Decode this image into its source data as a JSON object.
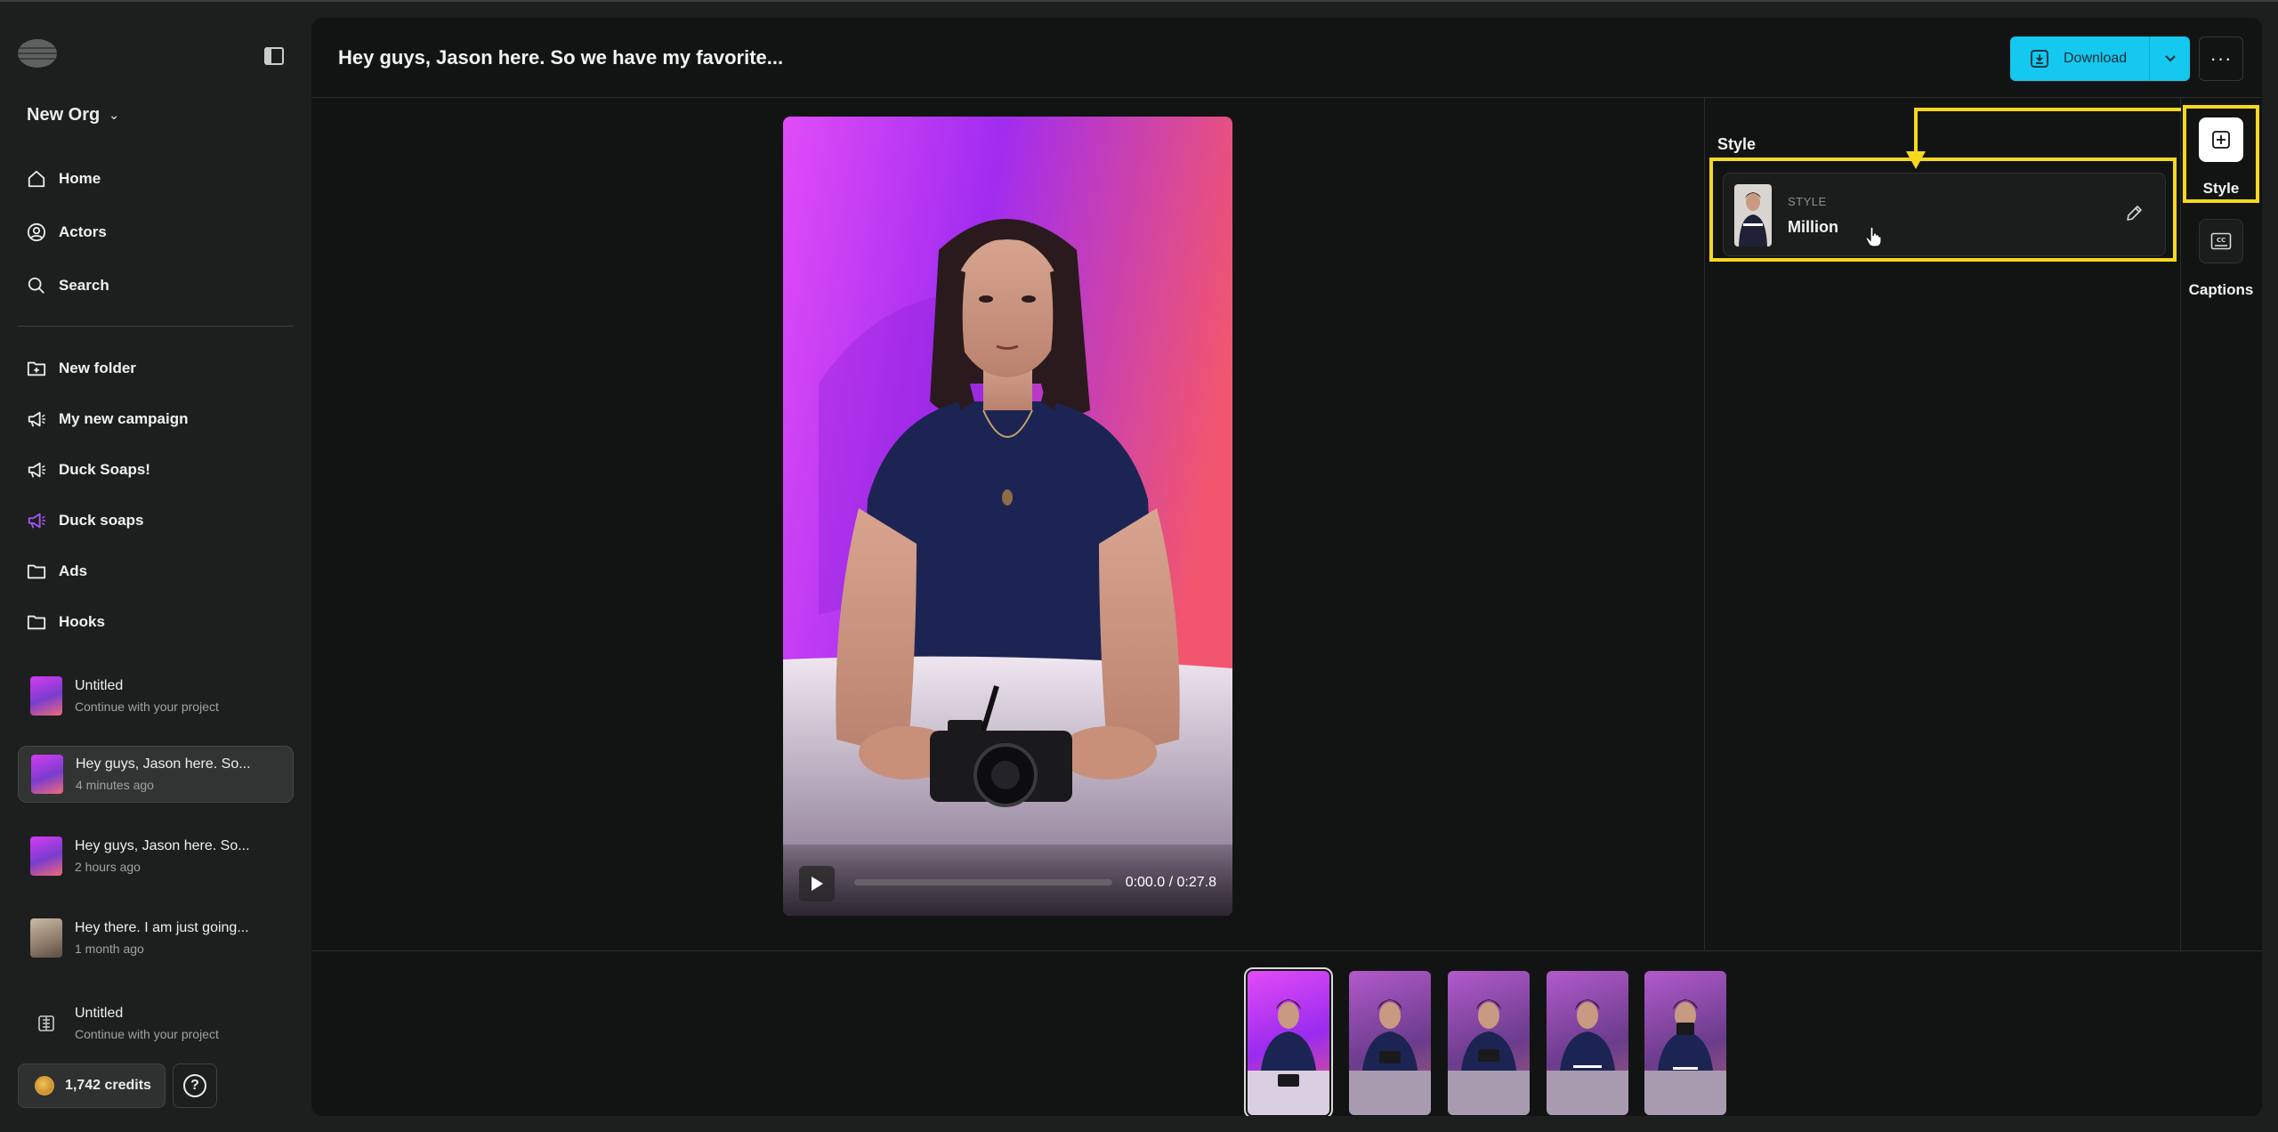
{
  "sidebar": {
    "org_name": "New Org",
    "nav": [
      {
        "label": "Home",
        "icon": "home-icon"
      },
      {
        "label": "Actors",
        "icon": "user-circle-icon"
      },
      {
        "label": "Search",
        "icon": "search-icon"
      }
    ],
    "folders": [
      {
        "label": "New folder",
        "icon": "folder-plus-icon"
      },
      {
        "label": "My new campaign",
        "icon": "megaphone-icon"
      },
      {
        "label": "Duck Soaps!",
        "icon": "megaphone-icon"
      },
      {
        "label": "Duck soaps",
        "icon": "megaphone-icon",
        "color": "#a855f7"
      },
      {
        "label": "Ads",
        "icon": "folder-icon"
      },
      {
        "label": "Hooks",
        "icon": "folder-icon"
      }
    ],
    "projects": [
      {
        "title": "Untitled",
        "subtitle": "Continue with your project"
      },
      {
        "title": "Hey guys, Jason here. So...",
        "subtitle": "4 minutes ago"
      },
      {
        "title": "Hey guys, Jason here. So...",
        "subtitle": "2 hours ago"
      },
      {
        "title": "Hey there. I am just going...",
        "subtitle": "1 month ago"
      },
      {
        "title": "Untitled",
        "subtitle": "Continue with your project"
      }
    ],
    "credits": "1,742 credits",
    "help_icon": "?"
  },
  "header": {
    "title": "Hey guys, Jason here. So we have my favorite...",
    "download_label": "Download"
  },
  "player": {
    "time": "0:00.0 / 0:27.8",
    "progress": 0
  },
  "style_panel": {
    "title": "Style",
    "card_label": "STYLE",
    "card_value": "Million"
  },
  "rail": {
    "style_label": "Style",
    "captions_label": "Captions"
  },
  "colors": {
    "accent": "#14c8ef",
    "highlight": "#f7d81e",
    "panel_bg": "#121413",
    "sidebar_bg": "#1d1f1e"
  }
}
